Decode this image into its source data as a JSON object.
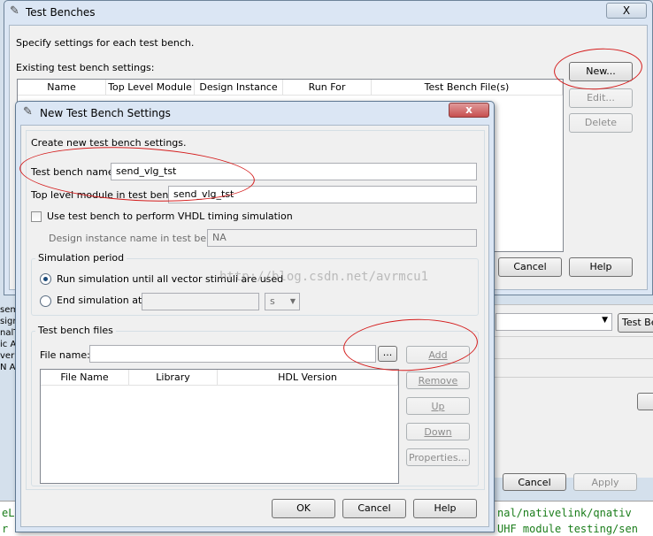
{
  "outer_dialog": {
    "title": "Test Benches",
    "close_label": "X",
    "description": "Specify settings for each test bench.",
    "existing_label": "Existing test bench settings:",
    "columns": [
      "Name",
      "Top Level Module",
      "Design Instance",
      "Run For",
      "Test Bench File(s)"
    ],
    "buttons": {
      "new": "New...",
      "edit": "Edit...",
      "delete": "Delete",
      "cancel": "Cancel",
      "help": "Help"
    }
  },
  "inner_dialog": {
    "title": "New Test Bench Settings",
    "close_label": "x",
    "description": "Create new test bench settings.",
    "test_bench_name_label": "Test bench name:",
    "test_bench_name_value": "send_vlg_tst",
    "top_level_label": "Top level module in test bench:",
    "top_level_value": "send_vlg_tst",
    "vhdl_checkbox_label": "Use test bench to perform VHDL timing simulation",
    "vhdl_checked": false,
    "design_instance_label": "Design instance name in test bench:",
    "design_instance_value": "NA",
    "simulation_period": {
      "group_label": "Simulation period",
      "option_run_all": "Run simulation until all vector stimuli are used",
      "option_end_at": "End simulation at:",
      "selected": "run_all",
      "unit": "s"
    },
    "test_bench_files": {
      "group_label": "Test bench files",
      "file_name_label": "File name:",
      "file_name_value": "",
      "browse_label": "...",
      "columns": [
        "File Name",
        "Library",
        "HDL Version"
      ],
      "buttons": {
        "add": "Add",
        "remove": "Remove",
        "up": "Up",
        "down": "Down",
        "properties": "Properties..."
      }
    },
    "buttons": {
      "ok": "OK",
      "cancel": "Cancel",
      "help": "Help"
    }
  },
  "background": {
    "watermark": "http://blog.csdn.net/avrmcu1",
    "side_labels": [
      "sem",
      "sign",
      "nalT",
      "ic A",
      "verl",
      "N A"
    ],
    "test_bench_button": "Test Be",
    "cancel": "Cancel",
    "apply": "Apply",
    "log_line_1": "nal/nativelink/qnativ",
    "log_line_2": "UHF module testing/sen",
    "log_left_1": "eLi",
    "log_left_2": "r e"
  },
  "colors": {
    "annotation": "#d41c1c",
    "dialog_bg": "#f0f0f0",
    "title_bar": "#dbe6f4",
    "close_button": "#c75050"
  }
}
